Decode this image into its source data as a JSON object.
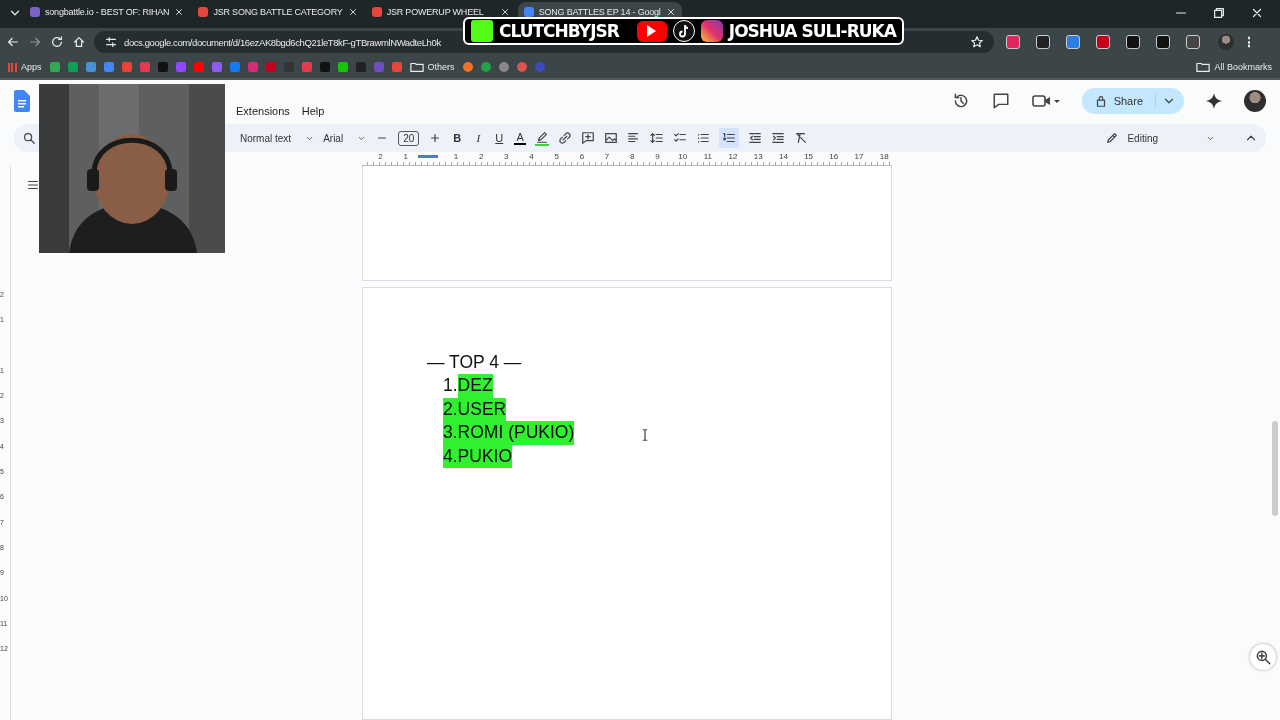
{
  "browser": {
    "tabs": [
      {
        "title": "songbattle.io - BEST OF: RIHAN",
        "selected": false,
        "color": "#7b61c9"
      },
      {
        "title": "JSR SONG BATTLE CATEGORY",
        "selected": false,
        "color": "#e8453c"
      },
      {
        "title": "JSR POWERUP WHEEL",
        "selected": false,
        "color": "#e8453c"
      },
      {
        "title": "SONG BATTLES EP 14 - Googl",
        "selected": true,
        "color": "#4285f4"
      }
    ],
    "url": "docs.google.com/document/d/16ezAK8bgd6chQ21leT8kF-gTBrawmlNWadteLh0k",
    "bookmarks_start": "Apps",
    "bookmark_icons": [
      {
        "color": "#34a853"
      },
      {
        "color": "#0f9d58"
      },
      {
        "color": "#4a90d9"
      },
      {
        "color": "#4285f4"
      },
      {
        "color": "#ea4335"
      },
      {
        "color": "#e53950"
      },
      {
        "color": "#111111"
      },
      {
        "color": "#9146ff"
      },
      {
        "color": "#ff0000"
      },
      {
        "color": "#8c5cf5"
      },
      {
        "color": "#1877f2"
      },
      {
        "color": "#d62976"
      },
      {
        "color": "#c4001d"
      }
    ],
    "bookmark_icons_2": [
      {
        "color": "#333333"
      },
      {
        "color": "#e53950"
      },
      {
        "color": "#111111"
      },
      {
        "color": "#16c60c"
      },
      {
        "color": "#222222"
      },
      {
        "color": "#6b4fbb"
      },
      {
        "color": "#e8453c"
      }
    ],
    "bookmark_folder": "Others",
    "bookmark_icons_3": [
      {
        "color": "#f36f21"
      },
      {
        "color": "#20a34a"
      },
      {
        "color": "#888888"
      },
      {
        "color": "#d9534f"
      },
      {
        "color": "#3b4cc0"
      }
    ],
    "extension_icons": [
      {
        "color": "#e0245e"
      },
      {
        "color": "#222222"
      },
      {
        "color": "#2a7de1"
      },
      {
        "color": "#c4001d"
      },
      {
        "color": "#111111"
      },
      {
        "color": "#111111"
      },
      {
        "color": "#444444"
      }
    ],
    "all_bookmarks": "All Bookmarks"
  },
  "overlay": {
    "handle": "CLUTCHBYJSR",
    "name": "JOSHUA SULI-RUKA"
  },
  "docs": {
    "menu": [
      "Extensions",
      "Help"
    ],
    "style": "Normal text",
    "font": "Arial",
    "font_size": "20",
    "format_buttons": [
      "B",
      "I",
      "U",
      "A"
    ],
    "share": "Share",
    "mode": "Editing",
    "numbered_list_on": true,
    "ruler": [
      "2",
      "1",
      "1",
      "2",
      "3",
      "4",
      "5",
      "6",
      "7",
      "8",
      "9",
      "10",
      "11",
      "12",
      "13",
      "14",
      "15",
      "16",
      "17",
      "18"
    ],
    "vertical_ruler": [
      "2",
      "1",
      "1",
      "2",
      "3",
      "4",
      "5",
      "6",
      "7",
      "8",
      "9",
      "10",
      "11",
      "12"
    ]
  },
  "document": {
    "heading": "— TOP 4 —",
    "list": [
      {
        "number": "1.",
        "text": "DEZ",
        "number_highlighted": false
      },
      {
        "number": "2.",
        "text": "USER",
        "number_highlighted": true
      },
      {
        "number": "3.",
        "text": "ROMI (PUKIO)",
        "number_highlighted": true
      },
      {
        "number": "4.",
        "text": "PUKIO",
        "number_highlighted": true
      }
    ]
  }
}
